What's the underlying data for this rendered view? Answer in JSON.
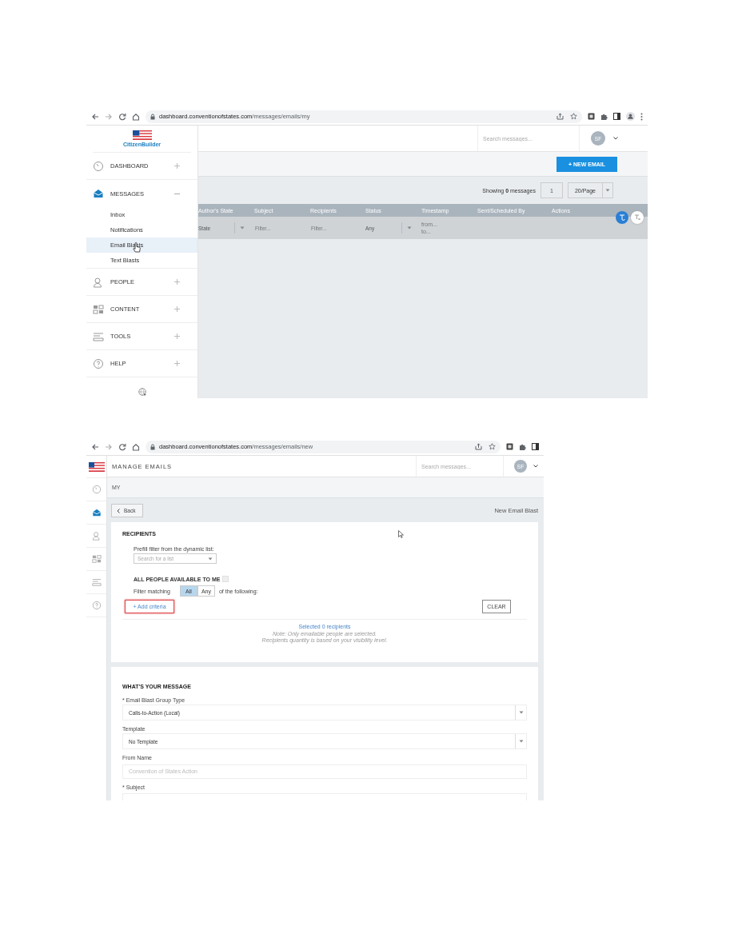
{
  "email_list_window": {
    "browser": {
      "url_host": "dashboard.conventionofstates.com",
      "url_path": "/messages/emails/my"
    },
    "sidebar": {
      "logo_text": "CitizenBuilder",
      "items": [
        {
          "label": "DASHBOARD",
          "selected": false,
          "expanded": false
        },
        {
          "label": "MESSAGES",
          "selected": true,
          "expanded": true,
          "children": [
            {
              "label": "Inbox",
              "selected": false
            },
            {
              "label": "Notifications",
              "selected": false
            },
            {
              "label": "Email Blasts",
              "selected": true
            },
            {
              "label": "Text Blasts",
              "selected": false
            }
          ]
        },
        {
          "label": "PEOPLE",
          "selected": false,
          "expanded": false
        },
        {
          "label": "CONTENT",
          "selected": false,
          "expanded": false
        },
        {
          "label": "TOOLS",
          "selected": false,
          "expanded": false
        },
        {
          "label": "HELP",
          "selected": false,
          "expanded": false
        }
      ]
    },
    "header": {
      "search_placeholder": "Search messages...",
      "avatar_initials": "SF"
    },
    "new_email_button": "+ NEW EMAIL",
    "pager": {
      "summary": "Showing **0** messages",
      "page": "1",
      "page_size": "20/Page"
    },
    "table": {
      "columns": [
        "Author's State",
        "Subject",
        "Recipients",
        "Status",
        "Timestamp",
        "Sent/Scheduled By",
        "Actions"
      ],
      "filters": [
        {
          "kind": "select",
          "value": "State"
        },
        {
          "kind": "text",
          "placeholder": "Filter..."
        },
        {
          "kind": "text",
          "placeholder": "Filter..."
        },
        {
          "kind": "select",
          "value": "Any"
        },
        {
          "kind": "range",
          "from_placeholder": "from...",
          "to_placeholder": "to..."
        }
      ]
    }
  },
  "new_email_window": {
    "browser": {
      "url_host": "dashboard.conventionofstates.com",
      "url_path": "/messages/emails/new"
    },
    "sidebar_icons": [
      {
        "selected": false
      },
      {
        "selected": true
      },
      {
        "selected": false
      },
      {
        "selected": false
      },
      {
        "selected": false
      },
      {
        "selected": false
      }
    ],
    "title": "MANAGE EMAILS",
    "header": {
      "search_placeholder": "Search messages...",
      "avatar_initials": "SF"
    },
    "breadcrumb": "MY",
    "back_button": "Back",
    "page_title": "New Email Blast",
    "recipients": {
      "heading": "RECIPIENTS",
      "prefill_label": "Prefill filter from the dynamic list:",
      "list_placeholder": "Search for a list",
      "all_people_label": "ALL PEOPLE AVAILABLE TO ME",
      "all_people_checked": false,
      "filter_prefix": "Filter matching",
      "match_options": [
        {
          "label": "All",
          "selected": true
        },
        {
          "label": "Any",
          "selected": false
        }
      ],
      "filter_suffix": "of the following:",
      "add_criteria": "+ Add criteria",
      "clear_button": "CLEAR",
      "selected_summary": "Selected 0 recipients",
      "notes": [
        "Note: Only emailable people are selected.",
        "Recipients quantity is based on your visibility level."
      ]
    },
    "message": {
      "heading": "WHAT'S YOUR MESSAGE",
      "fields": [
        {
          "kind": "select",
          "label": "* Email Blast Group Type",
          "value": "Calls-to-Action (Local)"
        },
        {
          "kind": "select",
          "label": "Template",
          "value": "No Template"
        },
        {
          "kind": "text",
          "label": "From Name",
          "placeholder": "Convention of States Action"
        },
        {
          "kind": "text",
          "label": "* Subject"
        }
      ]
    }
  }
}
